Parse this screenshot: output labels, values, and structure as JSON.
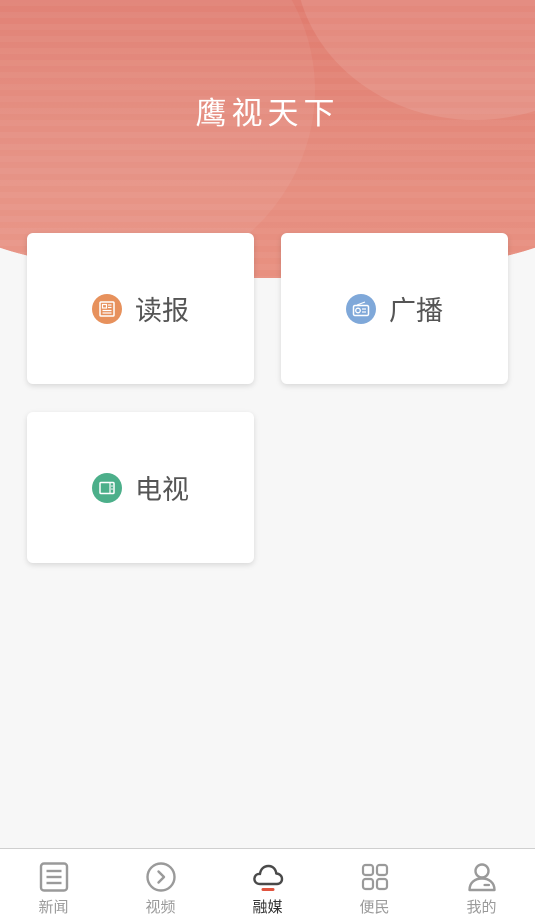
{
  "header": {
    "title": "鹰视天下"
  },
  "cards": [
    {
      "label": "读报",
      "icon": "newspaper-icon",
      "color": "#e7915c"
    },
    {
      "label": "广播",
      "icon": "radio-icon",
      "color": "#7fa8d9"
    },
    {
      "label": "电视",
      "icon": "tv-icon",
      "color": "#4caf8a"
    }
  ],
  "tabbar": {
    "active": "融媒",
    "accent": "#e0543f",
    "items": [
      {
        "label": "新闻",
        "icon": "news-list-icon"
      },
      {
        "label": "视频",
        "icon": "play-circle-icon"
      },
      {
        "label": "融媒",
        "icon": "cloud-icon"
      },
      {
        "label": "便民",
        "icon": "grid-icon"
      },
      {
        "label": "我的",
        "icon": "user-icon"
      }
    ]
  },
  "colors": {
    "header": "#e48274",
    "background": "#f7f7f7"
  }
}
